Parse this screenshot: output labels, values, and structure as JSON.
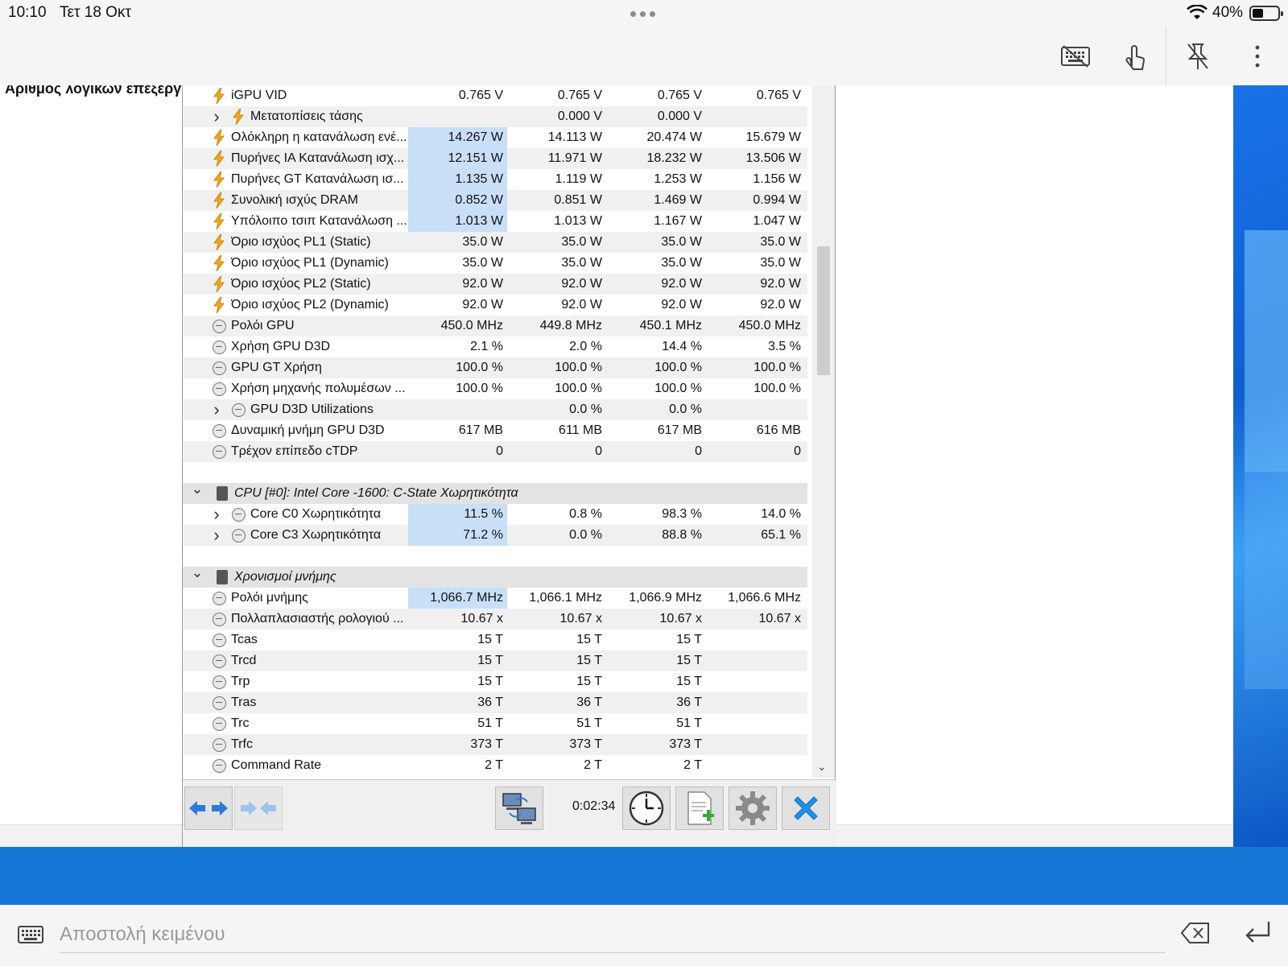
{
  "status_bar": {
    "time": "10:10",
    "date": "Τετ 18 Οκτ",
    "battery": "40%"
  },
  "background_window": {
    "heading": "Αριθμός λογικών επεξεργαστών"
  },
  "sensor_rows": [
    {
      "type": "data",
      "icon": "bolt",
      "level": 0,
      "label": "iGPU VID",
      "values": [
        "0.765 V",
        "0.765 V",
        "0.765 V",
        "0.765 V"
      ]
    },
    {
      "type": "data",
      "icon": "bolt",
      "level": 1,
      "expand": "collapsed",
      "label": "Μετατοπίσεις τάσης",
      "values": [
        "",
        "0.000 V",
        "0.000 V",
        ""
      ]
    },
    {
      "type": "data",
      "icon": "bolt",
      "level": 0,
      "highlight": true,
      "label": "Ολόκληρη η κατανάλωση ενέ...",
      "values": [
        "14.267 W",
        "14.113 W",
        "20.474 W",
        "15.679 W"
      ]
    },
    {
      "type": "data",
      "icon": "bolt",
      "level": 0,
      "highlight": true,
      "label": "Πυρήνες IA Κατανάλωση ισχ...",
      "values": [
        "12.151 W",
        "11.971 W",
        "18.232 W",
        "13.506 W"
      ]
    },
    {
      "type": "data",
      "icon": "bolt",
      "level": 0,
      "highlight": true,
      "label": "Πυρήνες GT Κατανάλωση ισ...",
      "values": [
        "1.135 W",
        "1.119 W",
        "1.253 W",
        "1.156 W"
      ]
    },
    {
      "type": "data",
      "icon": "bolt",
      "level": 0,
      "highlight": true,
      "label": "Συνολική ισχύς DRAM",
      "values": [
        "0.852 W",
        "0.851 W",
        "1.469 W",
        "0.994 W"
      ]
    },
    {
      "type": "data",
      "icon": "bolt",
      "level": 0,
      "highlight": true,
      "label": "Υπόλοιπο τσιπ Κατανάλωση ...",
      "values": [
        "1.013 W",
        "1.013 W",
        "1.167 W",
        "1.047 W"
      ]
    },
    {
      "type": "data",
      "icon": "bolt",
      "level": 0,
      "label": "Όριο ισχύος PL1 (Static)",
      "values": [
        "35.0 W",
        "35.0 W",
        "35.0 W",
        "35.0 W"
      ]
    },
    {
      "type": "data",
      "icon": "bolt",
      "level": 0,
      "label": "Όριο ισχύος PL1 (Dynamic)",
      "values": [
        "35.0 W",
        "35.0 W",
        "35.0 W",
        "35.0 W"
      ]
    },
    {
      "type": "data",
      "icon": "bolt",
      "level": 0,
      "label": "Όριο ισχύος PL2 (Static)",
      "values": [
        "92.0 W",
        "92.0 W",
        "92.0 W",
        "92.0 W"
      ]
    },
    {
      "type": "data",
      "icon": "bolt",
      "level": 0,
      "label": "Όριο ισχύος PL2 (Dynamic)",
      "values": [
        "92.0 W",
        "92.0 W",
        "92.0 W",
        "92.0 W"
      ]
    },
    {
      "type": "data",
      "icon": "clock",
      "level": 0,
      "label": "Ρολόι GPU",
      "values": [
        "450.0 MHz",
        "449.8 MHz",
        "450.1 MHz",
        "450.0 MHz"
      ]
    },
    {
      "type": "data",
      "icon": "clock",
      "level": 0,
      "label": "Χρήση GPU D3D",
      "values": [
        "2.1 %",
        "2.0 %",
        "14.4 %",
        "3.5 %"
      ]
    },
    {
      "type": "data",
      "icon": "clock",
      "level": 0,
      "label": "GPU GT Χρήση",
      "values": [
        "100.0 %",
        "100.0 %",
        "100.0 %",
        "100.0 %"
      ]
    },
    {
      "type": "data",
      "icon": "clock",
      "level": 0,
      "label": "Χρήση μηχανής πολυμέσων ...",
      "values": [
        "100.0 %",
        "100.0 %",
        "100.0 %",
        "100.0 %"
      ]
    },
    {
      "type": "data",
      "icon": "clock",
      "level": 1,
      "expand": "collapsed",
      "label": "GPU D3D Utilizations",
      "values": [
        "",
        "0.0 %",
        "0.0 %",
        ""
      ]
    },
    {
      "type": "data",
      "icon": "clock",
      "level": 0,
      "label": "Δυναμική μνήμη GPU D3D",
      "values": [
        "617 MB",
        "611 MB",
        "617 MB",
        "616 MB"
      ]
    },
    {
      "type": "data",
      "icon": "clock",
      "level": 0,
      "label": "Τρέχον επίπεδο cTDP",
      "values": [
        "0",
        "0",
        "0",
        "0"
      ]
    },
    {
      "type": "spacer"
    },
    {
      "type": "section",
      "icon": "chip",
      "expand": "expanded",
      "label": "CPU [#0]: Intel Core -1600: C-State Χωρητικότητα"
    },
    {
      "type": "data",
      "icon": "clock",
      "level": 1,
      "expand": "collapsed",
      "highlight": true,
      "label": "Core C0 Χωρητικότητα",
      "values": [
        "11.5 %",
        "0.8 %",
        "98.3 %",
        "14.0 %"
      ]
    },
    {
      "type": "data",
      "icon": "clock",
      "level": 1,
      "expand": "collapsed",
      "highlight": true,
      "label": "Core C3 Χωρητικότητα",
      "values": [
        "71.2 %",
        "0.0 %",
        "88.8 %",
        "65.1 %"
      ]
    },
    {
      "type": "spacer"
    },
    {
      "type": "section",
      "icon": "chip",
      "expand": "expanded",
      "label": "Χρονισμοί μνήμης"
    },
    {
      "type": "data",
      "icon": "clock",
      "level": 0,
      "highlight": true,
      "label": "Ρολόι μνήμης",
      "values": [
        "1,066.7 MHz",
        "1,066.1 MHz",
        "1,066.9 MHz",
        "1,066.6 MHz"
      ]
    },
    {
      "type": "data",
      "icon": "clock",
      "level": 0,
      "label": "Πολλαπλασιαστής ρολογιού ...",
      "values": [
        "10.67 x",
        "10.67 x",
        "10.67 x",
        "10.67 x"
      ]
    },
    {
      "type": "data",
      "icon": "clock",
      "level": 0,
      "label": "Tcas",
      "values": [
        "15 T",
        "15 T",
        "15 T",
        ""
      ]
    },
    {
      "type": "data",
      "icon": "clock",
      "level": 0,
      "label": "Trcd",
      "values": [
        "15 T",
        "15 T",
        "15 T",
        ""
      ]
    },
    {
      "type": "data",
      "icon": "clock",
      "level": 0,
      "label": "Trp",
      "values": [
        "15 T",
        "15 T",
        "15 T",
        ""
      ]
    },
    {
      "type": "data",
      "icon": "clock",
      "level": 0,
      "label": "Tras",
      "values": [
        "36 T",
        "36 T",
        "36 T",
        ""
      ]
    },
    {
      "type": "data",
      "icon": "clock",
      "level": 0,
      "label": "Trc",
      "values": [
        "51 T",
        "51 T",
        "51 T",
        ""
      ]
    },
    {
      "type": "data",
      "icon": "clock",
      "level": 0,
      "label": "Trfc",
      "values": [
        "373 T",
        "373 T",
        "373 T",
        ""
      ]
    },
    {
      "type": "data",
      "icon": "clock",
      "level": 0,
      "label": "Command Rate",
      "values": [
        "2 T",
        "2 T",
        "2 T",
        ""
      ]
    }
  ],
  "sensor_toolbar": {
    "timer": "0:02:34"
  },
  "input_bar": {
    "placeholder": "Αποστολή κειμένου"
  },
  "colors": {
    "highlight": "#c9dff7",
    "bolt": "#f2a71b",
    "windows_blue": "#1777d6",
    "close_blue": "#1e90e8"
  }
}
